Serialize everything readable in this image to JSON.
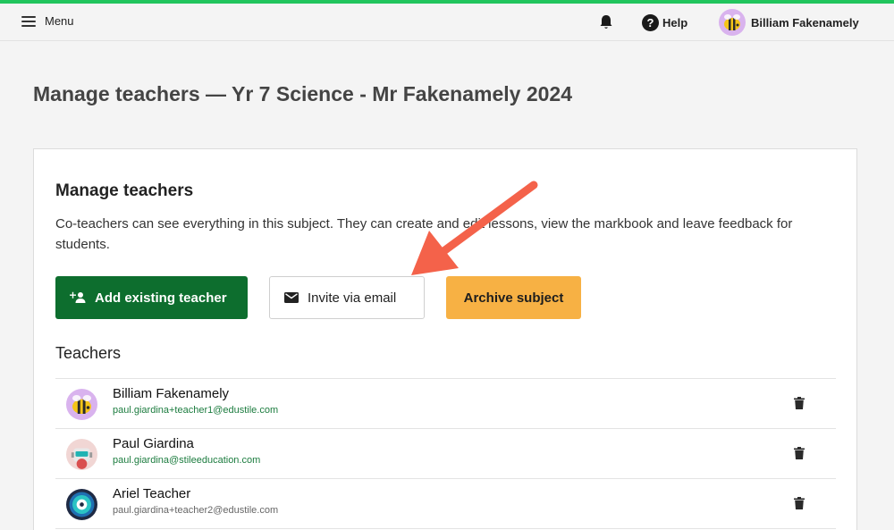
{
  "topbar": {
    "menu_label": "Menu",
    "help_label": "Help",
    "help_glyph": "?",
    "user_name": "Billiam Fakenamely",
    "accent_color": "#21c55d"
  },
  "page": {
    "title": "Manage teachers — Yr 7 Science - Mr Fakenamely 2024"
  },
  "card": {
    "title": "Manage teachers",
    "description": "Co-teachers can see everything in this subject. They can create and edit lessons, view the markbook and leave feedback for students.",
    "buttons": {
      "add_existing": "Add existing teacher",
      "invite_email": "Invite via email",
      "archive": "Archive subject"
    },
    "teachers_heading": "Teachers"
  },
  "teachers": [
    {
      "name": "Billiam Fakenamely",
      "email": "paul.giardina+teacher1@edustile.com",
      "avatar": "bee-avatar",
      "email_color": "#1c7c3f"
    },
    {
      "name": "Paul Giardina",
      "email": "paul.giardina@stileeducation.com",
      "avatar": "robot-avatar",
      "email_color": "#1c7c3f"
    },
    {
      "name": "Ariel Teacher",
      "email": "paul.giardina+teacher2@edustile.com",
      "avatar": "disc-avatar",
      "email_color": "#666666"
    }
  ],
  "colors": {
    "primary_green": "#0d6e2e",
    "archive_orange": "#f7b144",
    "annotation_arrow": "#f4624a"
  }
}
